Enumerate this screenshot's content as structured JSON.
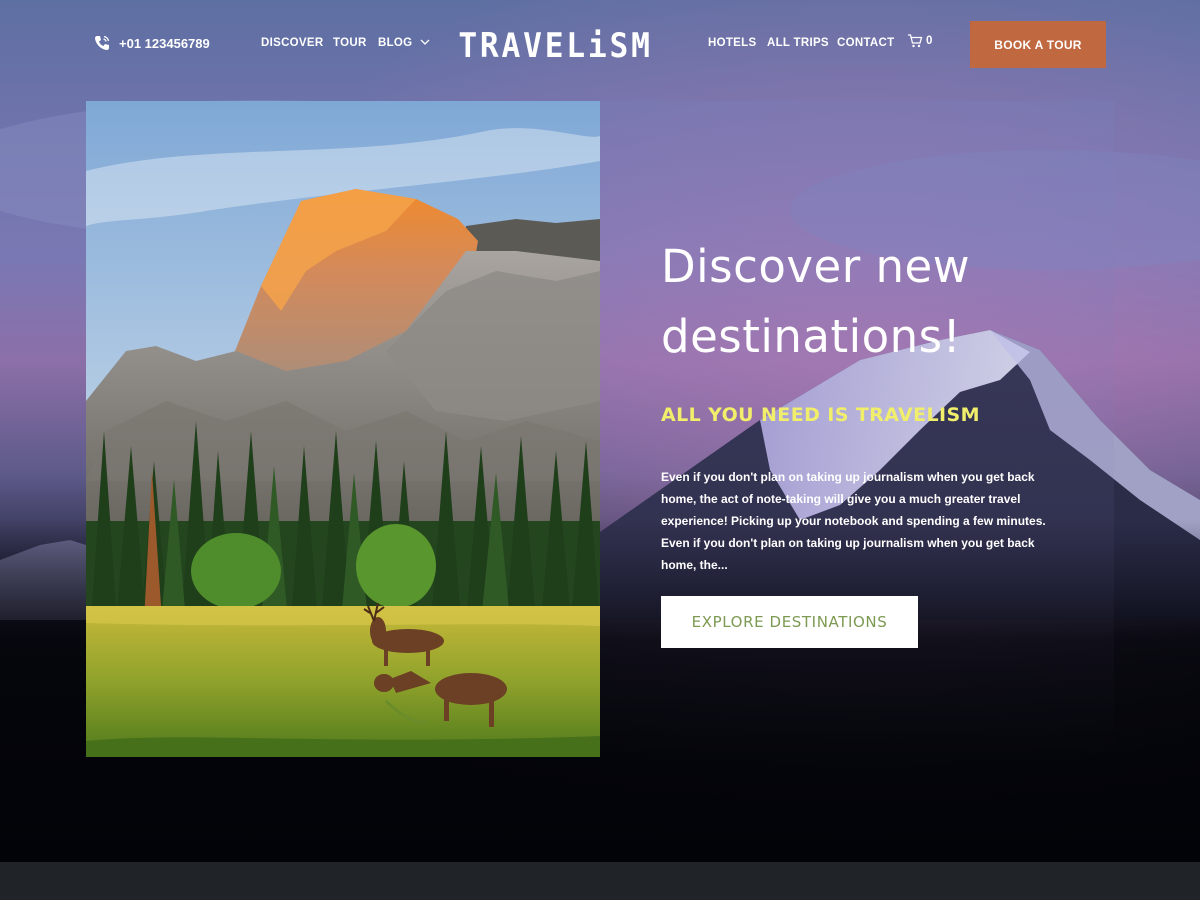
{
  "header": {
    "phone": "+01 123456789",
    "nav_left": [
      "DISCOVER",
      "TOUR",
      "BLOG"
    ],
    "logo": "TRAVELiSM",
    "nav_right": [
      "HOTELS",
      "ALL TRIPS",
      "CONTACT"
    ],
    "cart_count": "0",
    "book_button": "BOOK A TOUR"
  },
  "hero": {
    "title": "Discover new destinations!",
    "subtitle": "ALL YOU NEED IS TRAVELISM",
    "body": "Even if you don't plan on taking up journalism when you get back home, the act of note-taking will give you a much greater travel experience! Picking up your notebook and spending a few minutes. Even if you don't plan on taking up journalism when you get back home, the...",
    "cta": "EXPLORE DESTINATIONS"
  },
  "icons": {
    "phone": "phone-icon",
    "blog_dropdown": "chevron-down-icon",
    "cart": "cart-icon"
  },
  "colors": {
    "accent_button": "#c0683f",
    "subtitle": "#f0ee6a",
    "cta_text": "#7c9a52",
    "footer": "#202327"
  }
}
